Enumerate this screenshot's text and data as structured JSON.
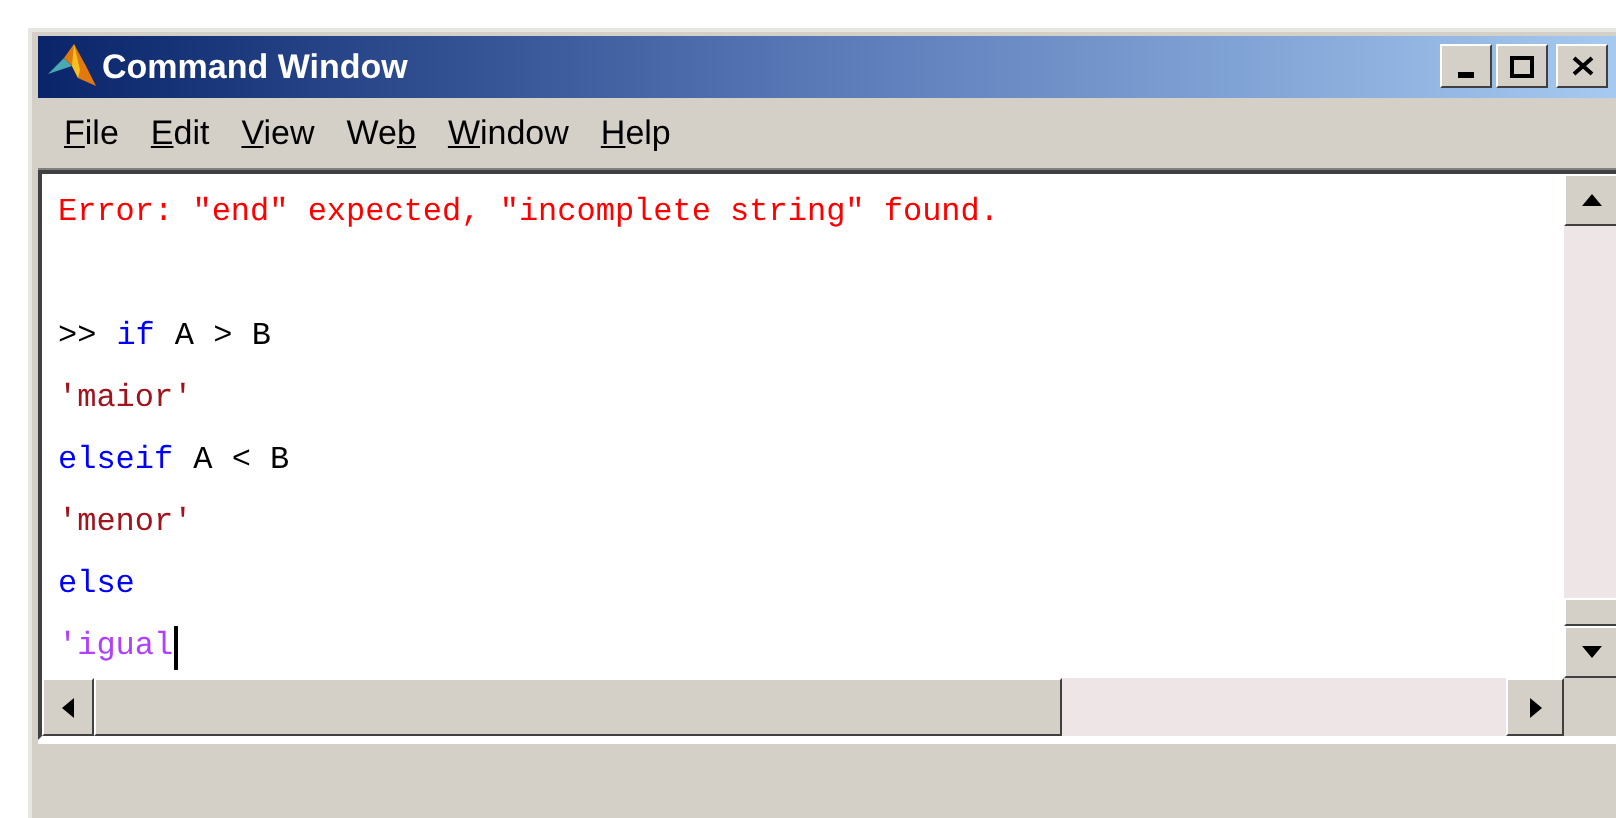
{
  "window": {
    "title": "Command Window"
  },
  "menu": [
    {
      "access_key": "F",
      "label_rest": "ile"
    },
    {
      "access_key": "E",
      "label_rest": "dit"
    },
    {
      "access_key": "V",
      "label_rest": "iew"
    },
    {
      "label_start": "We",
      "access_key": "b"
    },
    {
      "access_key": "W",
      "label_rest": "indow"
    },
    {
      "access_key": "H",
      "label_rest": "elp"
    }
  ],
  "error": "Error: \"end\" expected, \"incomplete string\" found.",
  "lines": [
    {
      "segments": [
        {
          "text": ">>",
          "kind": "prompt"
        },
        {
          "text": "if",
          "kind": "keyword"
        },
        {
          "text": "A > B",
          "kind": "plain"
        }
      ]
    },
    {
      "segments": [
        {
          "text": "'maior'",
          "kind": "string"
        }
      ]
    },
    {
      "segments": [
        {
          "text": "elseif",
          "kind": "keyword"
        },
        {
          "text": "A < B",
          "kind": "plain"
        }
      ]
    },
    {
      "segments": [
        {
          "text": "'menor'",
          "kind": "string"
        }
      ]
    },
    {
      "segments": [
        {
          "text": "else",
          "kind": "keyword"
        }
      ]
    },
    {
      "segments": [
        {
          "text": "'igual",
          "kind": "open_string"
        }
      ],
      "cursor": true
    }
  ]
}
